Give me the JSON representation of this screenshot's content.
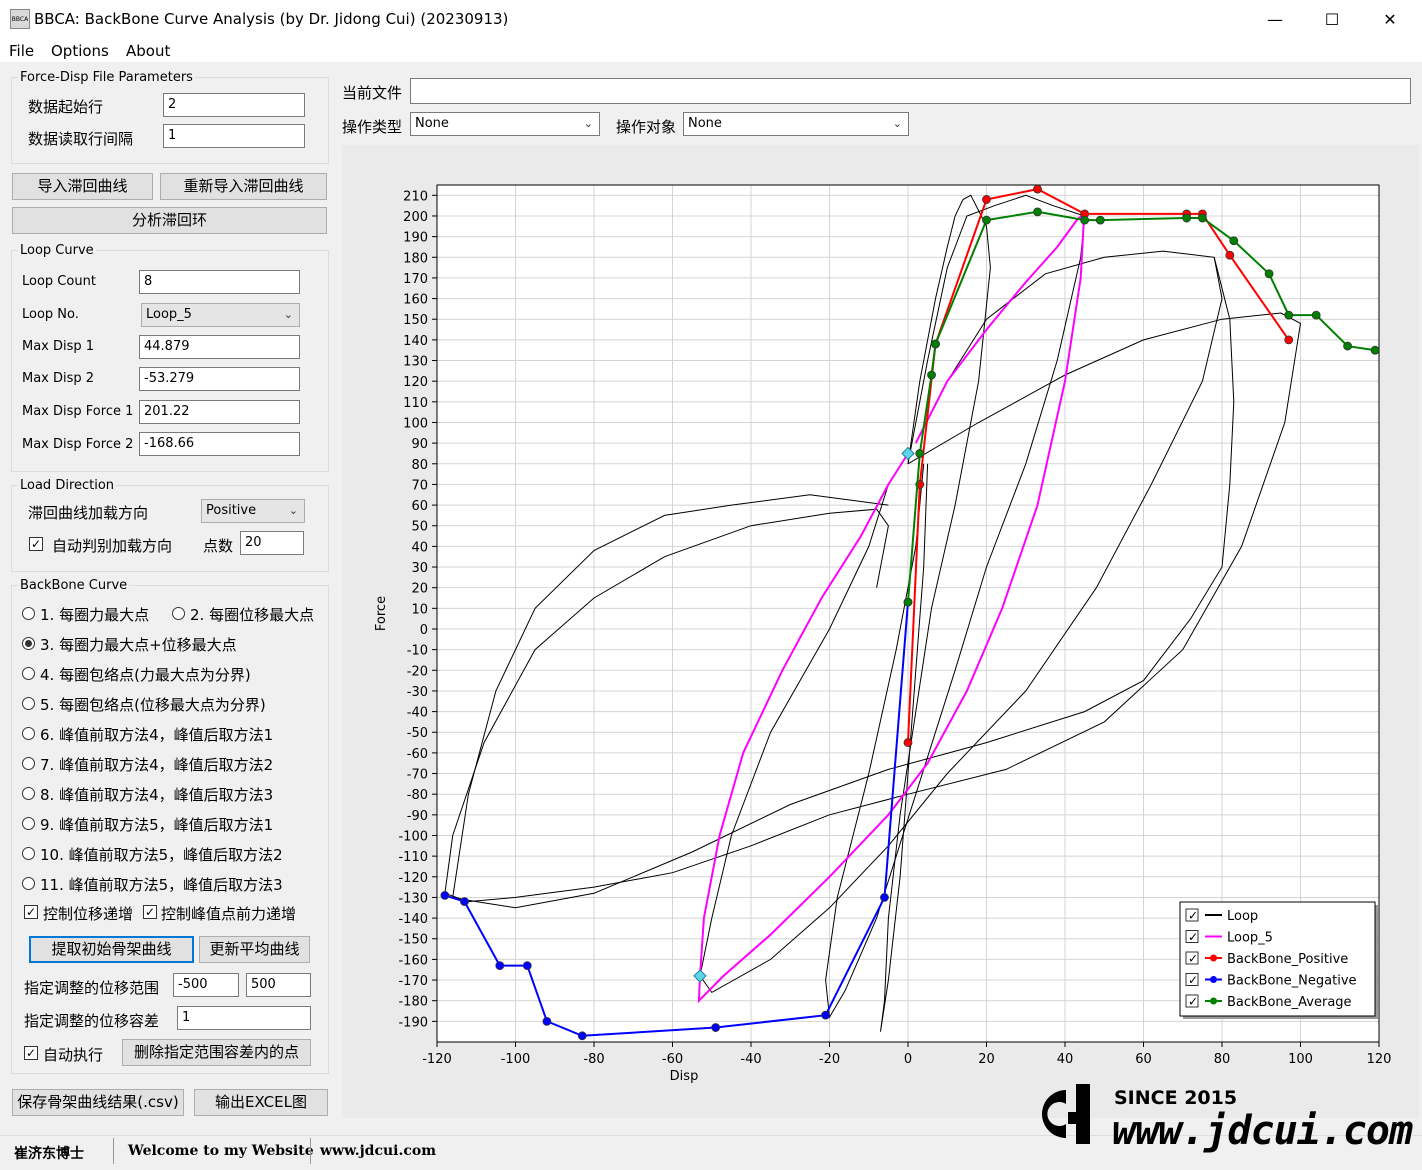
{
  "window": {
    "title": "BBCA: BackBone Curve Analysis (by Dr. Jidong Cui) (20230913)",
    "icon_text": "BBCA",
    "minimize": "—",
    "maximize": "☐",
    "close": "✕"
  },
  "menu": [
    "File",
    "Options",
    "About"
  ],
  "file_params": {
    "legend": "Force-Disp File Parameters",
    "start_row_label": "数据起始行",
    "start_row_value": "2",
    "interval_label": "数据读取行间隔",
    "interval_value": "1"
  },
  "buttons": {
    "import_loop": "导入滞回曲线",
    "reimport_loop": "重新导入滞回曲线",
    "analyze": "分析滞回环",
    "extract_backbone": "提取初始骨架曲线",
    "update_average": "更新平均曲线",
    "delete_points": "删除指定范围容差内的点",
    "save_csv": "保存骨架曲线结果(.csv)",
    "export_excel": "输出EXCEL图"
  },
  "loop_curve": {
    "legend": "Loop Curve",
    "count_label": "Loop Count",
    "count_value": "8",
    "no_label": "Loop No.",
    "no_value": "Loop_5",
    "max_disp1_label": "Max Disp 1",
    "max_disp1_value": "44.879",
    "max_disp2_label": "Max Disp 2",
    "max_disp2_value": "-53.279",
    "max_force1_label": "Max Disp Force 1",
    "max_force1_value": "201.22",
    "max_force2_label": "Max Disp Force 2",
    "max_force2_value": "-168.66"
  },
  "load_direction": {
    "legend": "Load Direction",
    "direction_label": "滞回曲线加载方向",
    "direction_value": "Positive",
    "auto_label": "自动判别加载方向",
    "points_label": "点数",
    "points_value": "20"
  },
  "backbone": {
    "legend": "BackBone Curve",
    "options": [
      "1. 每圈力最大点",
      "2. 每圈位移最大点",
      "3. 每圈力最大点+位移最大点",
      "4. 每圈包络点(力最大点为分界)",
      "5. 每圈包络点(位移最大点为分界)",
      "6. 峰值前取方法4，峰值后取方法1",
      "7. 峰值前取方法4，峰值后取方法2",
      "8. 峰值前取方法4，峰值后取方法3",
      "9. 峰值前取方法5，峰值后取方法1",
      "10. 峰值前取方法5，峰值后取方法2",
      "11. 峰值前取方法5，峰值后取方法3"
    ],
    "selected_index": 2,
    "disp_increase_label": "控制位移递增",
    "force_increase_label": "控制峰值点前力递增",
    "range_label": "指定调整的位移范围",
    "range_min": "-500",
    "range_max": "500",
    "tolerance_label": "指定调整的位移容差",
    "tolerance_value": "1",
    "auto_exec_label": "自动执行"
  },
  "top": {
    "current_file_label": "当前文件",
    "current_file_value": "",
    "op_type_label": "操作类型",
    "op_type_value": "None",
    "op_target_label": "操作对象",
    "op_target_value": "None"
  },
  "status": {
    "author": "崔济东博士",
    "welcome": "Welcome to my Website",
    "site": "www.jdcui.com"
  },
  "watermark": {
    "since": "SINCE 2015",
    "url": "www.jdcui.com"
  },
  "chart_data": {
    "type": "line",
    "xlabel": "Disp",
    "ylabel": "Force",
    "xlim": [
      -120,
      120
    ],
    "ylim": [
      -200,
      215
    ],
    "xticks": [
      -120,
      -100,
      -80,
      -60,
      -40,
      -20,
      0,
      20,
      40,
      60,
      80,
      100,
      120
    ],
    "yticks": [
      210,
      200,
      190,
      180,
      170,
      160,
      150,
      140,
      130,
      120,
      110,
      100,
      90,
      80,
      70,
      60,
      50,
      40,
      30,
      20,
      10,
      0,
      -10,
      -20,
      -30,
      -40,
      -50,
      -60,
      -70,
      -80,
      -90,
      -100,
      -110,
      -120,
      -130,
      -140,
      -150,
      -160,
      -170,
      -180,
      -190
    ],
    "grid": true,
    "legend_position": "bottom-right",
    "series": [
      {
        "name": "Loop",
        "color": "#000000",
        "markers": false,
        "loops": [
          [
            [
              0,
              80
            ],
            [
              3,
              120
            ],
            [
              7,
              160
            ],
            [
              10,
              185
            ],
            [
              12,
              200
            ],
            [
              14,
              208
            ],
            [
              16,
              210
            ],
            [
              20,
              195
            ],
            [
              21,
              175
            ],
            [
              18,
              120
            ],
            [
              12,
              60
            ],
            [
              6,
              10
            ],
            [
              2,
              -40
            ],
            [
              -2,
              -90
            ],
            [
              -5,
              -140
            ],
            [
              -6,
              -180
            ],
            [
              -7,
              -195
            ],
            [
              -5,
              -170
            ],
            [
              -2,
              -120
            ],
            [
              0,
              -70
            ],
            [
              2,
              -20
            ],
            [
              4,
              30
            ],
            [
              5,
              80
            ]
          ],
          [
            [
              0,
              80
            ],
            [
              5,
              130
            ],
            [
              10,
              175
            ],
            [
              15,
              200
            ],
            [
              22,
              205
            ],
            [
              30,
              210
            ],
            [
              37,
              205
            ],
            [
              45,
              200
            ],
            [
              44,
              180
            ],
            [
              38,
              130
            ],
            [
              30,
              80
            ],
            [
              20,
              30
            ],
            [
              12,
              -20
            ],
            [
              2,
              -80
            ],
            [
              -8,
              -140
            ],
            [
              -16,
              -175
            ],
            [
              -20,
              -188
            ],
            [
              -21,
              -170
            ],
            [
              -18,
              -130
            ],
            [
              -10,
              -70
            ],
            [
              -3,
              -10
            ],
            [
              2,
              40
            ],
            [
              4,
              80
            ]
          ],
          [
            [
              2,
              90
            ],
            [
              10,
              120
            ],
            [
              20,
              150
            ],
            [
              35,
              172
            ],
            [
              50,
              180
            ],
            [
              65,
              183
            ],
            [
              78,
              180
            ],
            [
              80,
              160
            ],
            [
              75,
              120
            ],
            [
              62,
              70
            ],
            [
              48,
              20
            ],
            [
              30,
              -30
            ],
            [
              10,
              -70
            ],
            [
              -5,
              -105
            ],
            [
              -20,
              -135
            ],
            [
              -35,
              -160
            ],
            [
              -50,
              -176
            ],
            [
              -53,
              -168
            ],
            [
              -50,
              -140
            ],
            [
              -45,
              -100
            ],
            [
              -35,
              -50
            ],
            [
              -20,
              0
            ],
            [
              -10,
              40
            ],
            [
              -5,
              70
            ],
            [
              0,
              85
            ]
          ],
          [
            [
              0,
              80
            ],
            [
              18,
              100
            ],
            [
              40,
              123
            ],
            [
              60,
              140
            ],
            [
              80,
              150
            ],
            [
              95,
              153
            ],
            [
              100,
              148
            ],
            [
              96,
              100
            ],
            [
              85,
              40
            ],
            [
              70,
              -10
            ],
            [
              50,
              -45
            ],
            [
              25,
              -68
            ],
            [
              0,
              -80
            ],
            [
              -20,
              -90
            ],
            [
              -40,
              -105
            ],
            [
              -60,
              -118
            ],
            [
              -80,
              -125
            ],
            [
              -100,
              -130
            ],
            [
              -112,
              -132
            ],
            [
              -118,
              -128
            ],
            [
              -116,
              -100
            ],
            [
              -108,
              -55
            ],
            [
              -95,
              -10
            ],
            [
              -80,
              15
            ],
            [
              -62,
              35
            ],
            [
              -40,
              50
            ],
            [
              -20,
              56
            ],
            [
              -8,
              58
            ],
            [
              -5,
              50
            ],
            [
              -8,
              20
            ]
          ],
          [
            [
              -5,
              60
            ],
            [
              -25,
              65
            ],
            [
              -45,
              60
            ],
            [
              -62,
              55
            ],
            [
              -80,
              38
            ],
            [
              -95,
              10
            ],
            [
              -105,
              -30
            ],
            [
              -112,
              -80
            ],
            [
              -116,
              -130
            ],
            [
              -110,
              -132
            ],
            [
              -100,
              -135
            ],
            [
              -80,
              -128
            ],
            [
              -55,
              -108
            ],
            [
              -30,
              -85
            ],
            [
              -5,
              -68
            ],
            [
              20,
              -55
            ],
            [
              45,
              -40
            ],
            [
              60,
              -25
            ],
            [
              72,
              5
            ],
            [
              80,
              30
            ],
            [
              82,
              70
            ],
            [
              83,
              110
            ],
            [
              82,
              150
            ],
            [
              78,
              180
            ]
          ]
        ]
      },
      {
        "name": "Loop_5",
        "color": "#ff00ff",
        "markers": false,
        "loops": [
          [
            [
              2,
              90
            ],
            [
              10,
              120
            ],
            [
              20,
              145
            ],
            [
              30,
              168
            ],
            [
              38,
              185
            ],
            [
              43,
              198
            ],
            [
              44.879,
              201.22
            ],
            [
              44,
              170
            ],
            [
              40,
              120
            ],
            [
              33,
              60
            ],
            [
              24,
              10
            ],
            [
              15,
              -30
            ],
            [
              5,
              -65
            ],
            [
              -5,
              -90
            ],
            [
              -20,
              -120
            ],
            [
              -35,
              -148
            ],
            [
              -47,
              -168
            ],
            [
              -53.279,
              -180
            ],
            [
              -53,
              -168
            ],
            [
              -52,
              -140
            ],
            [
              -48,
              -100
            ],
            [
              -42,
              -60
            ],
            [
              -32,
              -20
            ],
            [
              -22,
              15
            ],
            [
              -12,
              45
            ],
            [
              -5,
              70
            ],
            [
              0,
              85
            ]
          ]
        ]
      },
      {
        "name": "BackBone_Positive",
        "color": "#ff0000",
        "markers": true,
        "points": [
          [
            0,
            -55
          ],
          [
            3,
            70
          ],
          [
            7,
            138
          ],
          [
            20,
            208
          ],
          [
            33,
            213
          ],
          [
            45,
            201
          ],
          [
            71,
            201
          ],
          [
            75,
            201
          ],
          [
            82,
            181
          ],
          [
            97,
            140
          ]
        ]
      },
      {
        "name": "BackBone_Negative",
        "color": "#0000ff",
        "markers": true,
        "points": [
          [
            0,
            13
          ],
          [
            -6,
            -130
          ],
          [
            -21,
            -187
          ],
          [
            -49,
            -193
          ],
          [
            -83,
            -197
          ],
          [
            -92,
            -190
          ],
          [
            -97,
            -163
          ],
          [
            -104,
            -163
          ],
          [
            -113,
            -132
          ],
          [
            -118,
            -129
          ]
        ]
      },
      {
        "name": "BackBone_Average",
        "color": "#008000",
        "markers": true,
        "points": [
          [
            0,
            13
          ],
          [
            3,
            85
          ],
          [
            6,
            123
          ],
          [
            7,
            138
          ],
          [
            20,
            198
          ],
          [
            33,
            202
          ],
          [
            45,
            198
          ],
          [
            49,
            198
          ],
          [
            71,
            199
          ],
          [
            75,
            199
          ],
          [
            83,
            188
          ],
          [
            92,
            172
          ],
          [
            97,
            152
          ],
          [
            104,
            152
          ],
          [
            112,
            137
          ],
          [
            119,
            135
          ]
        ]
      }
    ],
    "highlight_points": [
      [
        0,
        85
      ],
      [
        -53,
        -168
      ]
    ]
  }
}
